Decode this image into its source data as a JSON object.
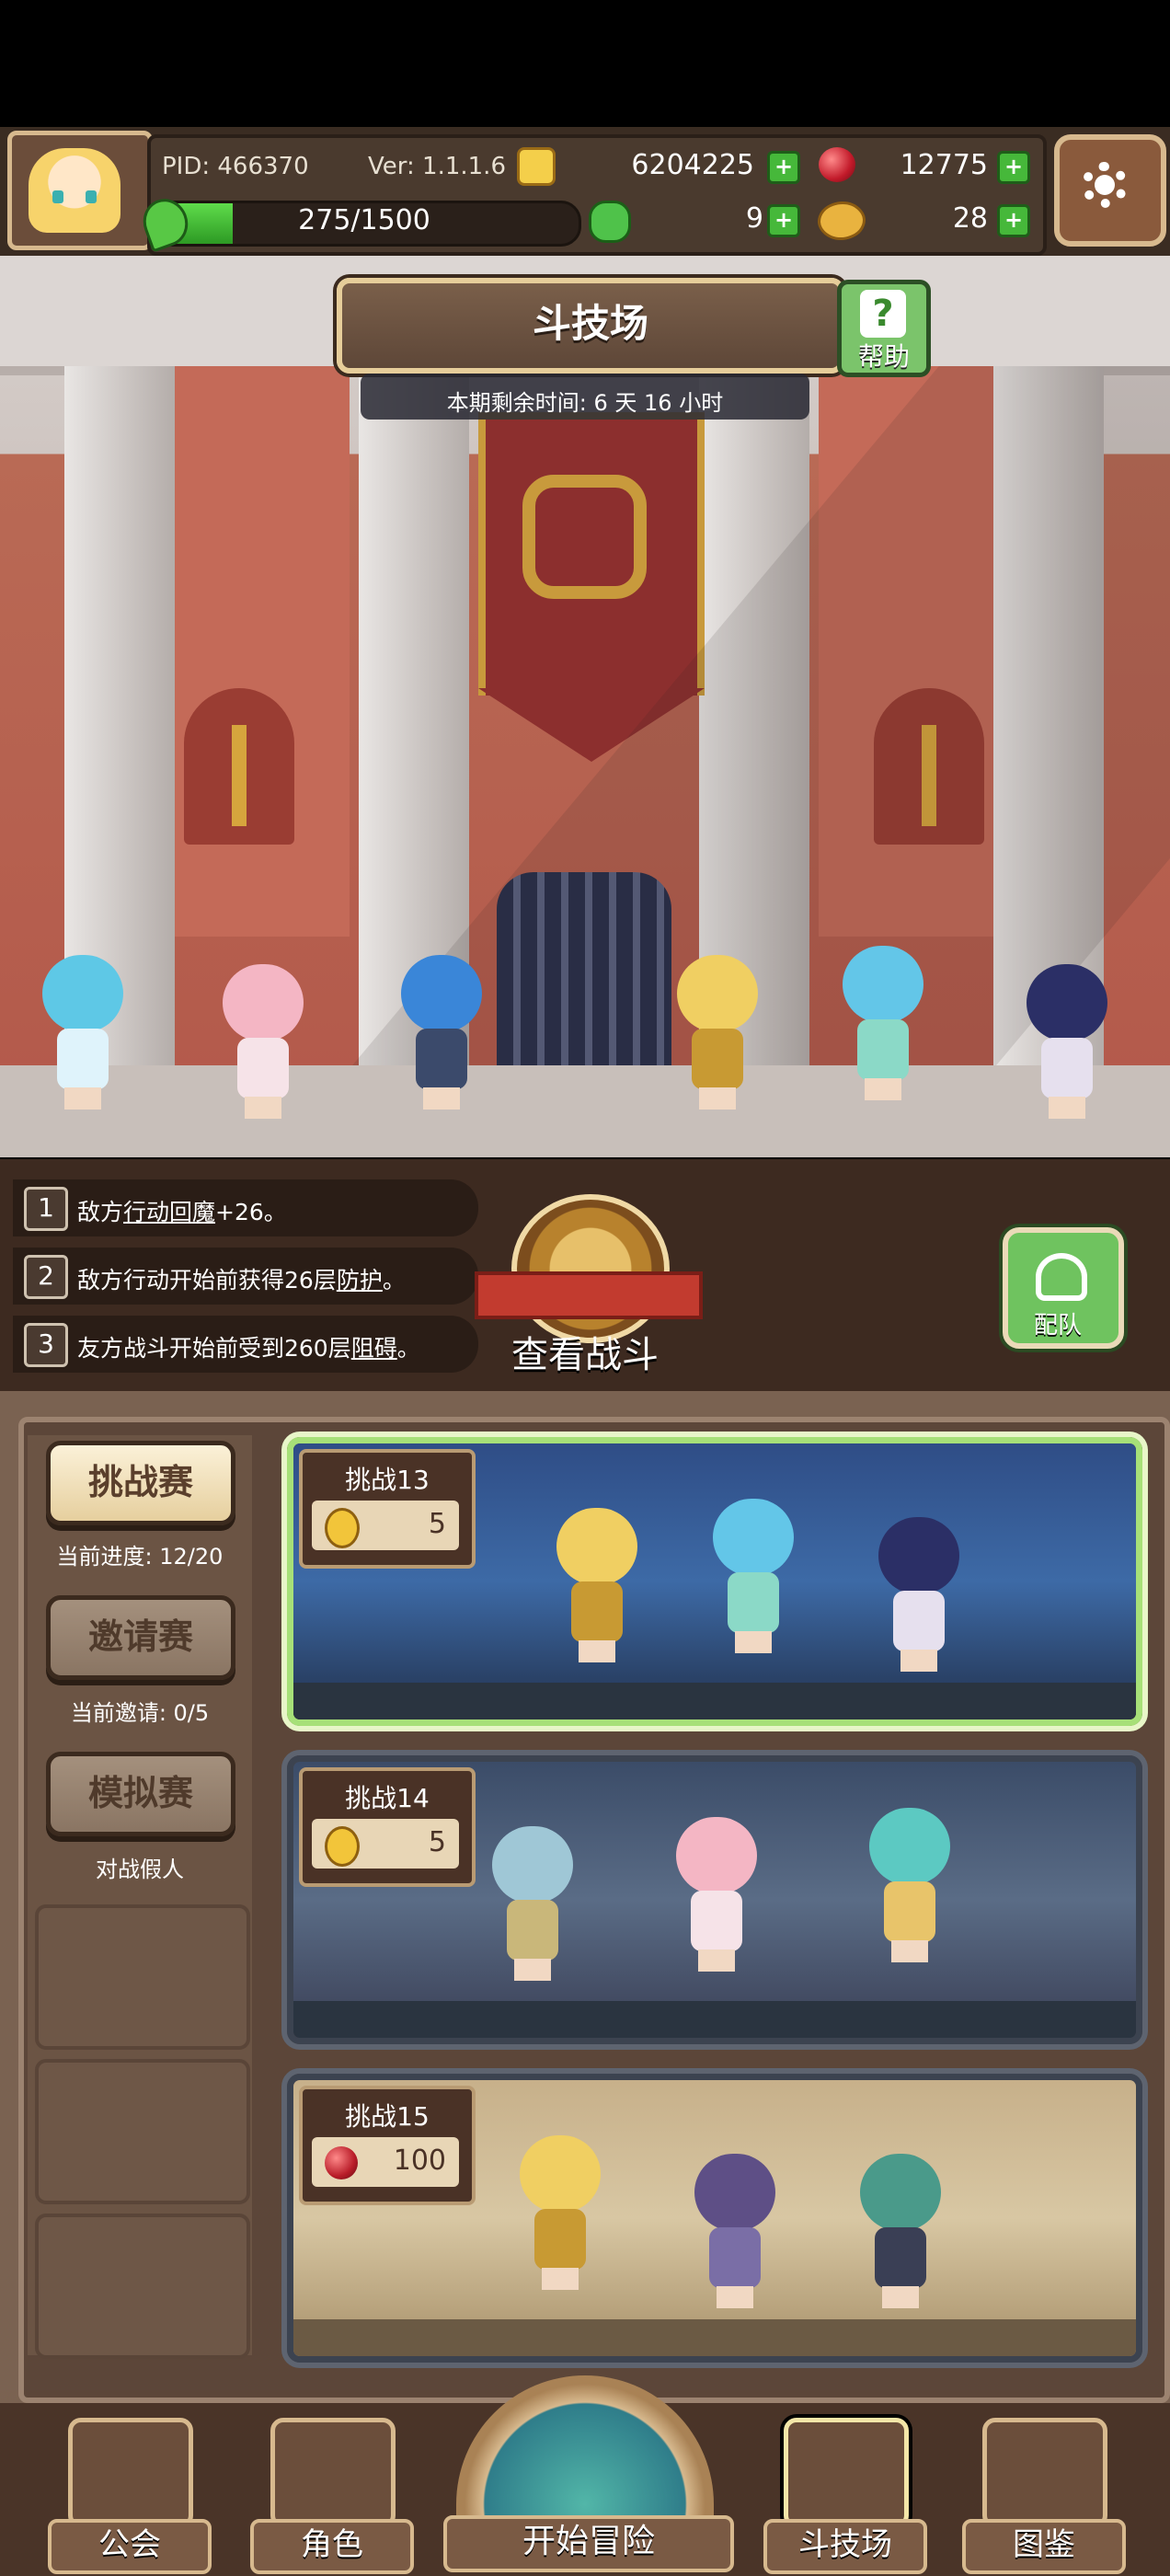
{
  "header": {
    "pid": "PID: 466370",
    "version": "Ver: 1.1.1.6",
    "coins": "6204225",
    "gems": "12775",
    "energy": "275/1500",
    "energy_fraction": 0.183,
    "clover": "9",
    "bread": "28"
  },
  "arena": {
    "title": "斗技场",
    "help_label": "帮助",
    "timer": "本期剩余时间: 6 天 16 小时"
  },
  "buffs": [
    {
      "num": "1",
      "pre": "敌方",
      "link": "行动回魔",
      "post": "+26。"
    },
    {
      "num": "2",
      "pre": "敌方行动开始前获得26层",
      "link": "防护",
      "post": "。"
    },
    {
      "num": "3",
      "pre": "友方战斗开始前受到260层",
      "link": "阻碍",
      "post": "。"
    }
  ],
  "battle": {
    "view_label": "查看战斗",
    "team_label": "配队"
  },
  "tabs": [
    {
      "label": "挑战赛",
      "sub": "当前进度: 12/20"
    },
    {
      "label": "邀请赛",
      "sub": "当前邀请: 0/5"
    },
    {
      "label": "模拟赛",
      "sub": "对战假人"
    }
  ],
  "challenges": [
    {
      "title": "挑战13",
      "cost": "5",
      "currency": "coin-icon"
    },
    {
      "title": "挑战14",
      "cost": "5",
      "currency": "coin-icon"
    },
    {
      "title": "挑战15",
      "cost": "100",
      "currency": "gem-icon"
    }
  ],
  "nav": {
    "guild": "公会",
    "character": "角色",
    "adventure": "开始冒险",
    "arena": "斗技场",
    "codex": "图鉴"
  }
}
